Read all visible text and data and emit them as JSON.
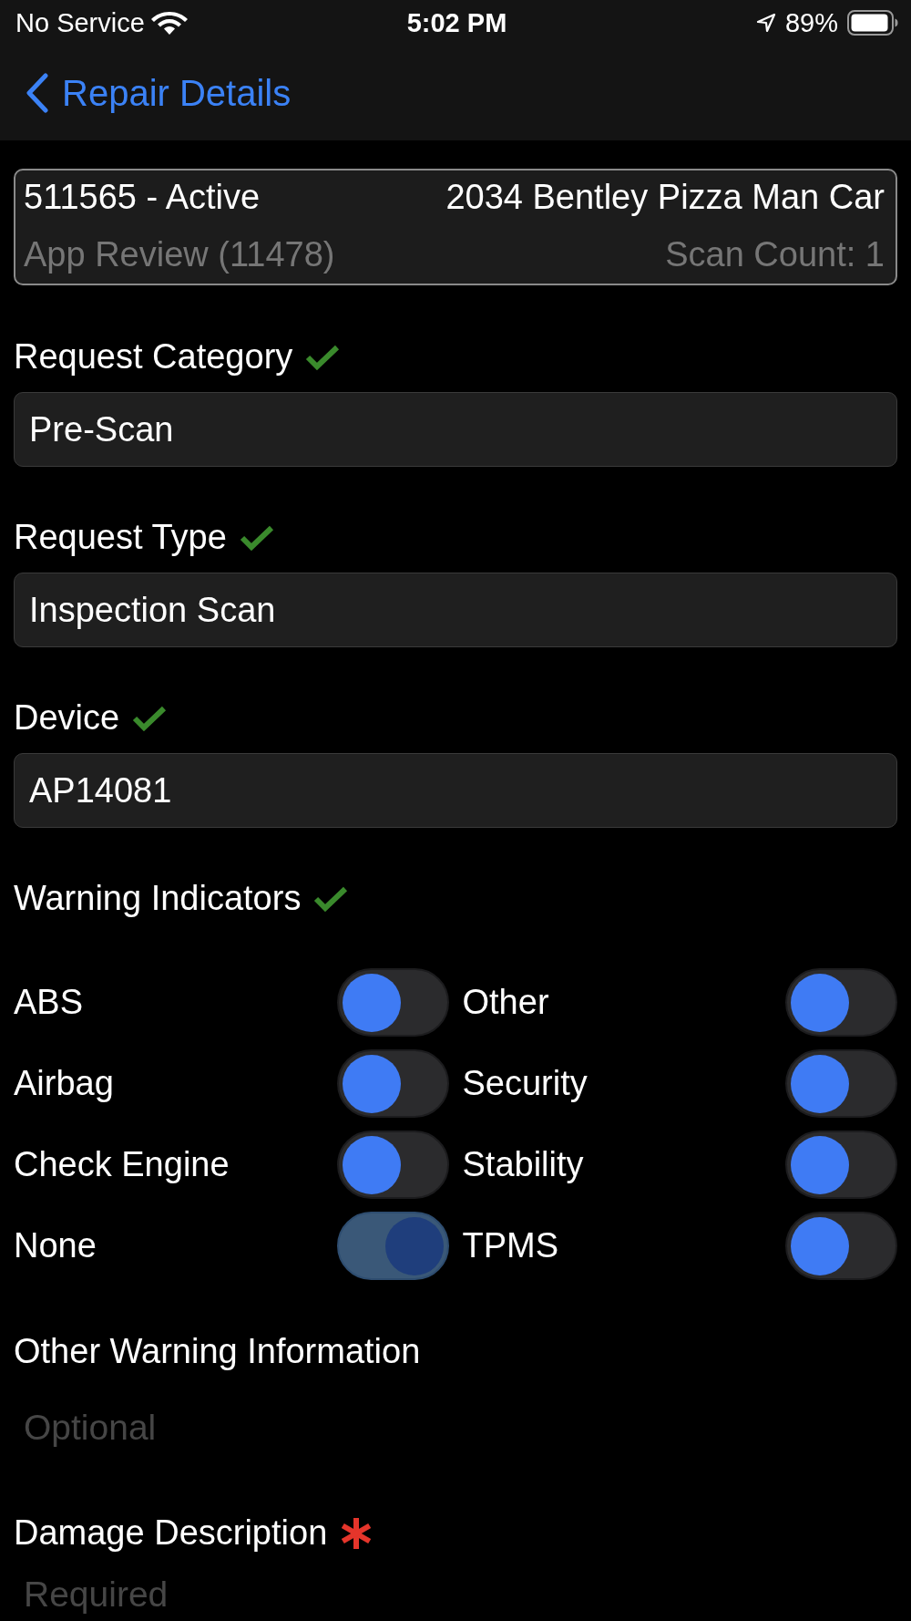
{
  "status_bar": {
    "carrier": "No Service",
    "time": "5:02 PM",
    "battery": "89%"
  },
  "nav": {
    "back_label": "Repair Details"
  },
  "summary": {
    "order": "511565 - Active",
    "vehicle": "2034 Bentley Pizza Man Car",
    "account": "App Review (11478)",
    "scan_count": "Scan Count: 1"
  },
  "fields": [
    {
      "label": "Request Category",
      "valid": true,
      "value": "Pre-Scan"
    },
    {
      "label": "Request Type",
      "valid": true,
      "value": "Inspection Scan"
    },
    {
      "label": "Device",
      "valid": true,
      "value": "AP14081"
    }
  ],
  "warning_indicators": {
    "label": "Warning Indicators",
    "valid": true,
    "toggles": [
      {
        "label": "ABS",
        "on": false
      },
      {
        "label": "Airbag",
        "on": false
      },
      {
        "label": "Check Engine",
        "on": false
      },
      {
        "label": "None",
        "on": true
      },
      {
        "label": "Other",
        "on": false
      },
      {
        "label": "Security",
        "on": false
      },
      {
        "label": "Stability",
        "on": false
      },
      {
        "label": "TPMS",
        "on": false
      }
    ]
  },
  "text_fields": [
    {
      "label": "Other Warning Information",
      "valid": false,
      "required": false,
      "placeholder": "Optional"
    },
    {
      "label": "Damage Description",
      "valid": false,
      "required": true,
      "placeholder": "Required"
    }
  ]
}
